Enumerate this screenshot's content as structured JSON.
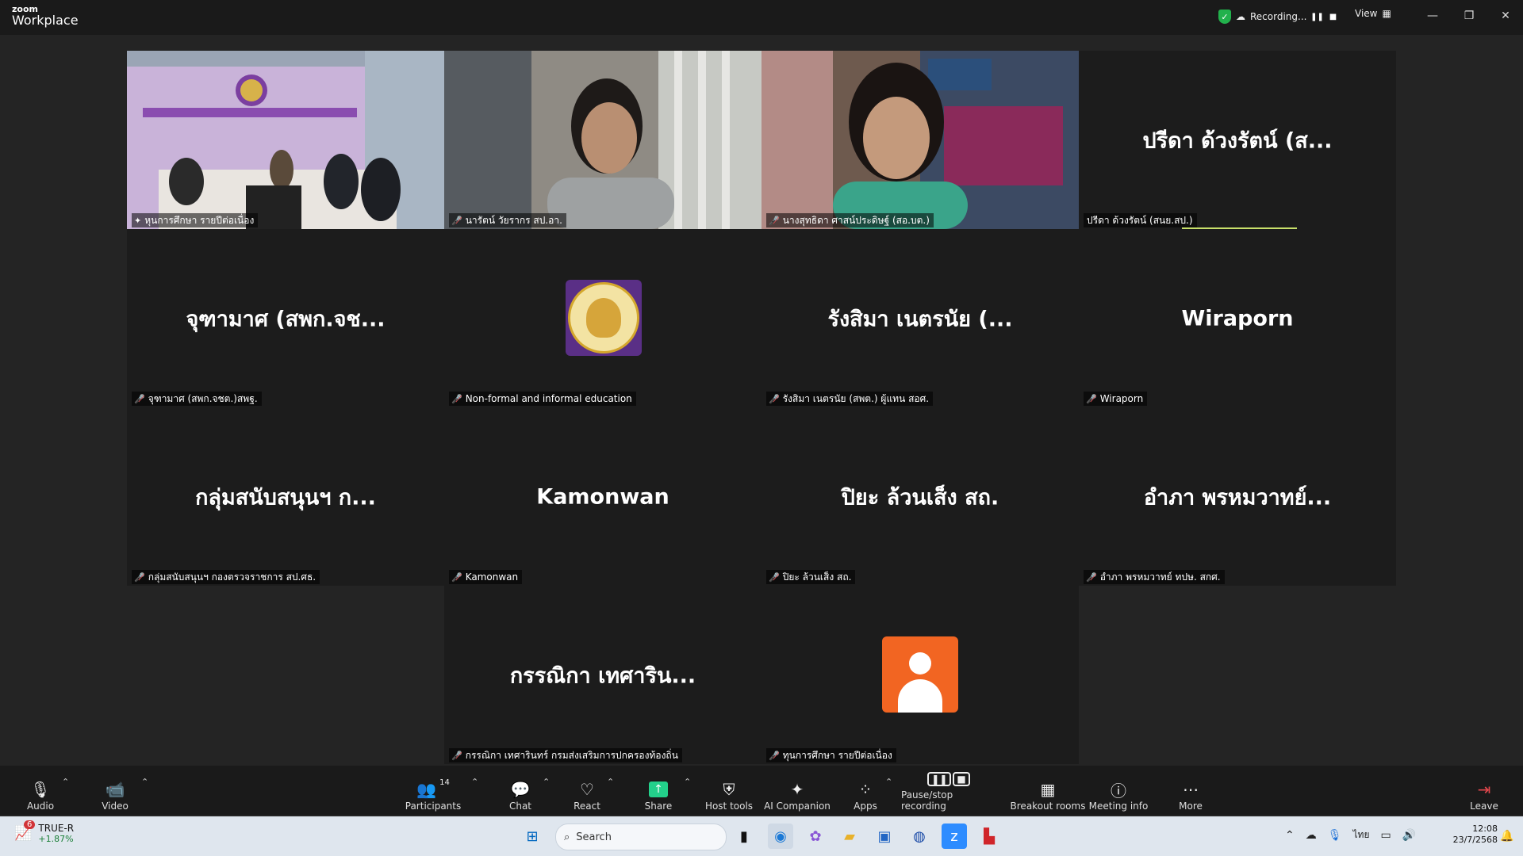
{
  "app": {
    "brand_small": "zoom",
    "brand_big": "Workplace"
  },
  "titlebar": {
    "recording_label": "Recording...",
    "view_label": "View"
  },
  "tiles": [
    {
      "big": "",
      "label": "หุนการศึกษา รายปีต่อเนื่อง"
    },
    {
      "big": "",
      "label": "นารัตน์ วัยรากร สป.อา."
    },
    {
      "big": "",
      "label": "นางสุทธิดา ศาสน์ประดิษฐ์ (สอ.บต.)"
    },
    {
      "big": "ปรีดา ด้วงรัตน์ (ส...",
      "label": "ปรีดา ด้วงรัตน์ (สนย.สป.)"
    },
    {
      "big": "จุฑามาศ (สพก.จช...",
      "label": "จุฑามาศ (สพก.จชต.)สพฐ."
    },
    {
      "big": "",
      "label": "Non-formal and informal education"
    },
    {
      "big": "รังสิมา  เนตรนัย (...",
      "label": "รังสิมา  เนตรนัย (สพต.) ผู้แทน สอศ."
    },
    {
      "big": "Wiraporn",
      "label": "Wiraporn"
    },
    {
      "big": "กลุ่มสนับสนุนฯ ก...",
      "label": "กลุ่มสนับสนุนฯ กองตรวจราชการ สป.ศธ."
    },
    {
      "big": "Kamonwan",
      "label": "Kamonwan"
    },
    {
      "big": "ปิยะ ล้วนเส็ง สถ.",
      "label": "ปิยะ ล้วนเส็ง สถ."
    },
    {
      "big": "อำภา พรหมวาทย์...",
      "label": "อำภา พรหมวาทย์ ทปษ. สกศ."
    },
    {
      "big": "กรรณิกา เทศาริน...",
      "label": "กรรณิกา เทศารินทร์ กรมส่งเสริมการปกครองท้องถิ่น"
    },
    {
      "big": "",
      "label": "ทุนการศึกษา รายปีต่อเนื่อง"
    }
  ],
  "toolbar": {
    "audio": "Audio",
    "video": "Video",
    "participants": "Participants",
    "participants_count": "14",
    "chat": "Chat",
    "react": "React",
    "share": "Share",
    "host_tools": "Host tools",
    "ai_companion": "AI Companion",
    "apps": "Apps",
    "pause_stop": "Pause/stop recording",
    "breakout": "Breakout rooms",
    "meeting_info": "Meeting info",
    "more": "More",
    "leave": "Leave"
  },
  "taskbar": {
    "stock_name": "TRUE-R",
    "stock_change": "+1.87%",
    "stock_badge": "6",
    "search_placeholder": "Search",
    "language": "ไทย",
    "time": "12:08",
    "date": "23/7/2568"
  },
  "colors": {
    "active_speaker": "#23d18b",
    "share_green": "#23d18b",
    "avatar_orange": "#f26522",
    "muted_red": "#e5484d"
  }
}
